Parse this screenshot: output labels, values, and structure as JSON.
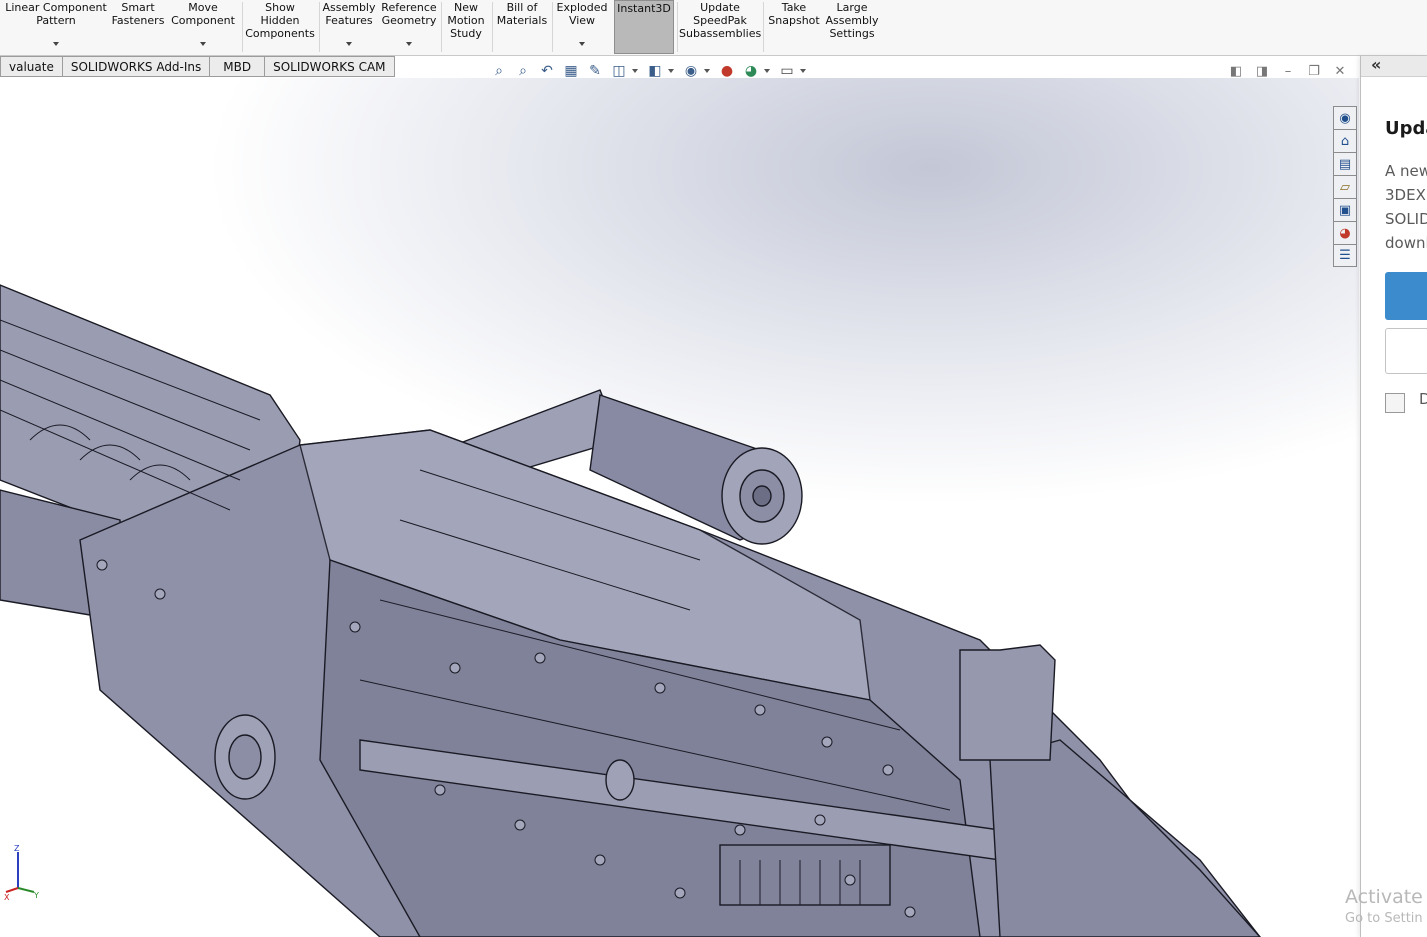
{
  "ribbon": {
    "buttons": [
      {
        "label": "Linear Component\nPattern",
        "caret": true
      },
      {
        "label": "Smart\nFasteners",
        "caret": false
      },
      {
        "label": "Move\nComponent",
        "caret": true
      },
      {
        "label": "Show\nHidden\nComponents",
        "caret": false
      },
      {
        "label": "Assembly\nFeatures",
        "caret": true
      },
      {
        "label": "Reference\nGeometry",
        "caret": true
      },
      {
        "label": "New\nMotion\nStudy",
        "caret": false
      },
      {
        "label": "Bill of\nMaterials",
        "caret": false
      },
      {
        "label": "Exploded\nView",
        "caret": true
      },
      {
        "label": "Instant3D",
        "caret": false,
        "active": true
      },
      {
        "label": "Update\nSpeedPak\nSubassemblies",
        "caret": false
      },
      {
        "label": "Take\nSnapshot",
        "caret": false
      },
      {
        "label": "Large\nAssembly\nSettings",
        "caret": false
      }
    ]
  },
  "tabs": [
    "valuate",
    "SOLIDWORKS Add-Ins",
    "MBD",
    "SOLIDWORKS CAM"
  ],
  "hud": {
    "icons": [
      "zoom-to-fit-icon",
      "zoom-to-area-icon",
      "previous-view-icon",
      "section-view-icon",
      "dynamic-annotation-icon",
      "view-orientation-icon",
      "display-style-icon",
      "hide-show-items-icon",
      "edit-appearance-icon",
      "apply-scene-icon",
      "view-settings-icon"
    ]
  },
  "window_controls": [
    "tile-left-icon",
    "tile-right-icon",
    "minimize-icon",
    "restore-icon",
    "close-icon"
  ],
  "task_pane": {
    "collapse_glyph": "«",
    "tabs": [
      "solidworks-resources-icon",
      "home-icon",
      "design-library-icon",
      "file-explorer-icon",
      "view-palette-icon",
      "appearances-icon",
      "custom-properties-icon"
    ]
  },
  "update_panel": {
    "title": "Upda",
    "lines": [
      "A new",
      "3DEX",
      "SOLID",
      "downlo"
    ],
    "checkbox_label": "D"
  },
  "watermark": {
    "line1": "Activate W",
    "line2": "Go to Settin"
  },
  "triad": {
    "z": "Z",
    "x": "X",
    "y": "Y"
  },
  "colors": {
    "accent_button": "#3c8ccd",
    "model_fill": "#8e90a8",
    "model_edge": "#1a1a24"
  }
}
